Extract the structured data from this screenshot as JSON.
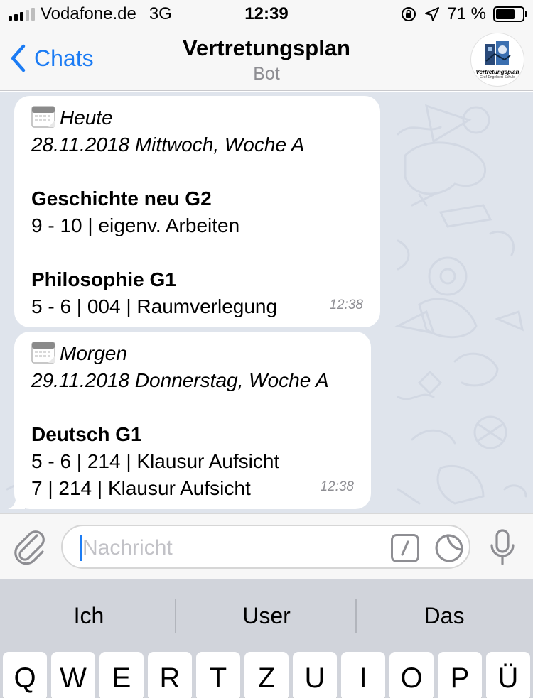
{
  "status_bar": {
    "carrier": "Vodafone.de",
    "network": "3G",
    "time": "12:39",
    "battery": "71 %",
    "battery_level": 0.71
  },
  "nav": {
    "back_label": "Chats",
    "title": "Vertretungsplan",
    "subtitle": "Bot",
    "avatar_text": "Vertretungsplan",
    "avatar_subtext": "Graf-Engelbert-Schule"
  },
  "messages": [
    {
      "header_day": "Heute",
      "header_date": "28.11.2018 Mittwoch, Woche A",
      "sections": [
        {
          "subject": "Geschichte neu G2",
          "lines": [
            "9 - 10 | eigenv. Arbeiten"
          ]
        },
        {
          "subject": "Philosophie G1",
          "lines": [
            "5 - 6 | 004 | Raumverlegung"
          ]
        }
      ],
      "time": "12:38"
    },
    {
      "header_day": "Morgen",
      "header_date": "29.11.2018 Donnerstag, Woche A",
      "sections": [
        {
          "subject": "Deutsch G1",
          "lines": [
            "5 - 6 | 214 | Klausur Aufsicht",
            "7 | 214 | Klausur Aufsicht"
          ]
        }
      ],
      "time": "12:38"
    }
  ],
  "input": {
    "placeholder": "Nachricht"
  },
  "keyboard": {
    "suggestions": [
      "Ich",
      "User",
      "Das"
    ],
    "top_row": [
      "Q",
      "W",
      "E",
      "R",
      "T",
      "Z",
      "U",
      "I",
      "O",
      "P",
      "Ü"
    ]
  },
  "colors": {
    "accent": "#1c7cf4",
    "chat_background": "#dfe4ec",
    "bubble": "#ffffff",
    "timestamp": "#8e8e93"
  }
}
